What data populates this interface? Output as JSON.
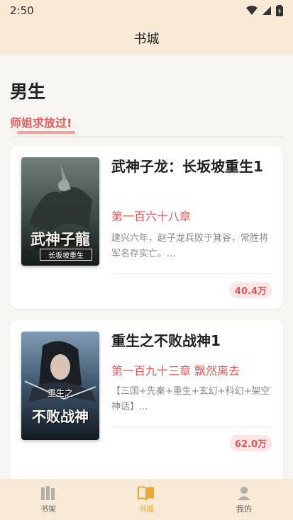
{
  "status": {
    "time": "2:50"
  },
  "header": {
    "title": "书城"
  },
  "section": {
    "title": "男生",
    "subtab": "师姐求放过!"
  },
  "books": [
    {
      "title": "武神子龙：长坂坡重生1",
      "chapter": "第一百六十八章",
      "description": "建兴六年，赵子龙兵败于箕谷，常胜将军名存实亡。...",
      "count": "40.4万",
      "cover_text": [
        "武神子龍",
        "长坂坡重生"
      ],
      "cover_colors": [
        "#4a5a54",
        "#1d2422"
      ]
    },
    {
      "title": "重生之不败战神1",
      "chapter": "第一百九十三章 飘然离去",
      "description": "【三国+先秦+重生+玄幻+科幻+架空神话】...",
      "count": "62.0万",
      "cover_text": [
        "重生之",
        "不败战神"
      ],
      "cover_colors": [
        "#46607a",
        "#18222d"
      ]
    }
  ],
  "tabbar": {
    "items": [
      {
        "label": "书架",
        "icon": "bookshelf-icon",
        "active": false
      },
      {
        "label": "书城",
        "icon": "open-book-icon",
        "active": true
      },
      {
        "label": "我的",
        "icon": "profile-icon",
        "active": false
      }
    ]
  },
  "colors": {
    "accent": "#e8a838",
    "red": "#e05c5c",
    "header_bg": "#f8ead6"
  }
}
